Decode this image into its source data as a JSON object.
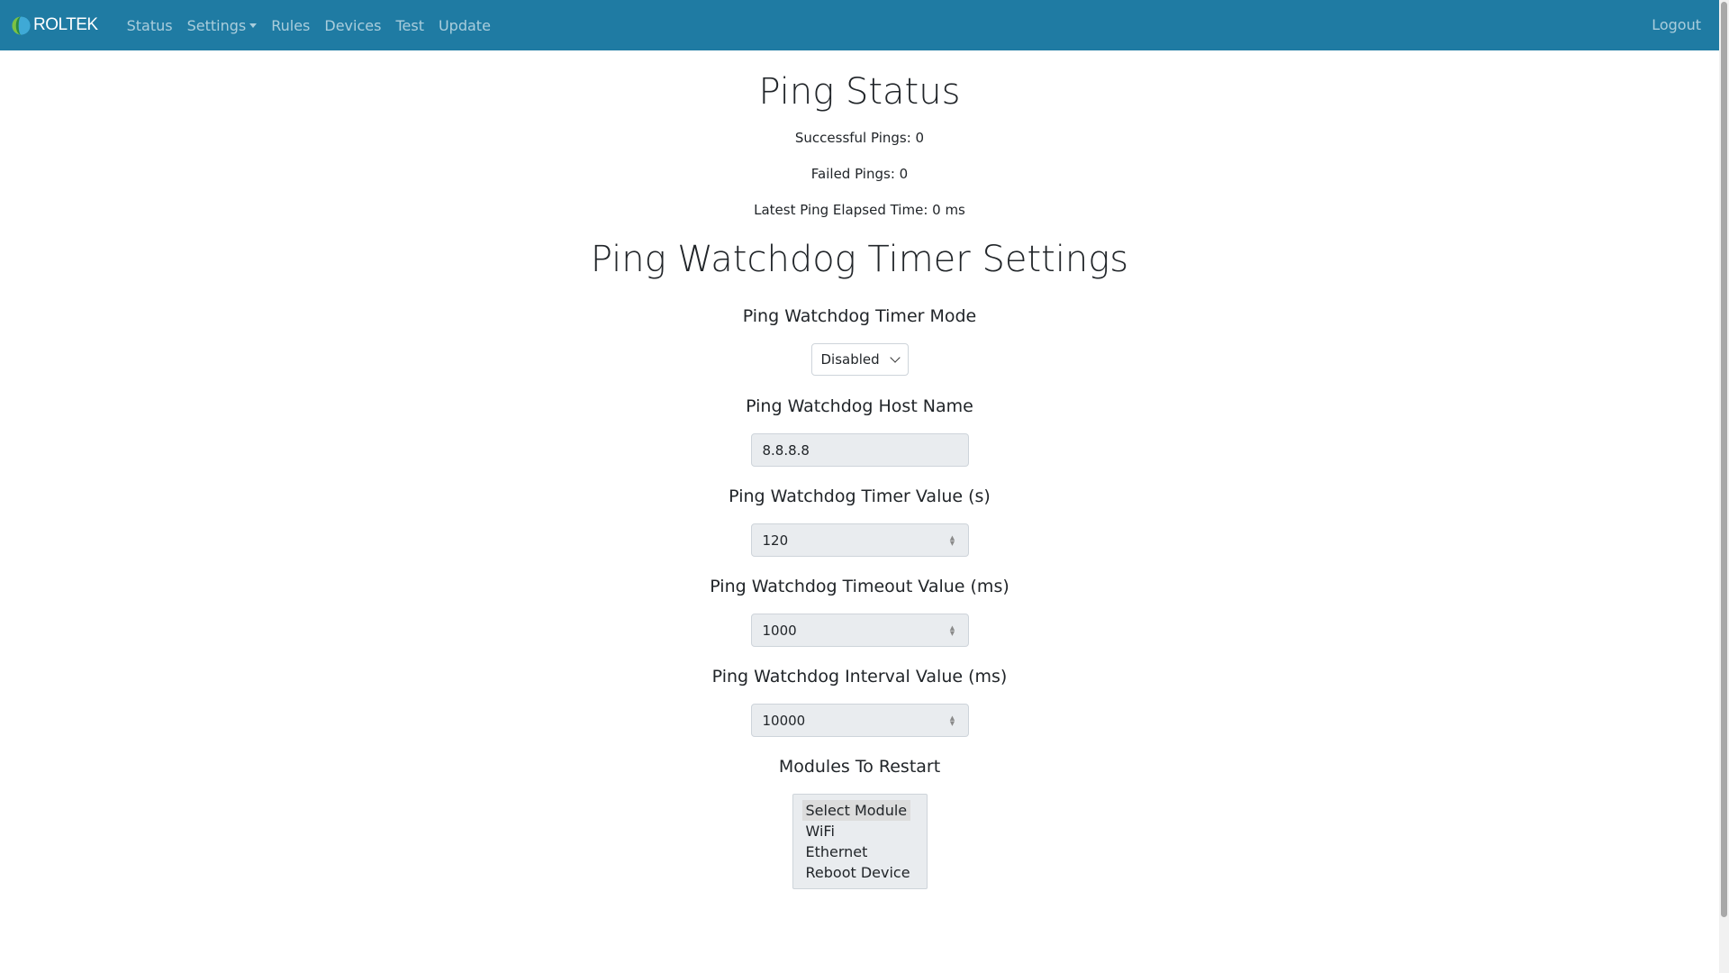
{
  "nav": {
    "brand": "ROLTEK",
    "items": [
      "Status",
      "Settings",
      "Rules",
      "Devices",
      "Test",
      "Update"
    ],
    "logout": "Logout"
  },
  "status": {
    "title": "Ping Status",
    "successful": "Successful Pings: 0",
    "failed": "Failed Pings: 0",
    "latest": "Latest Ping Elapsed Time: 0 ms"
  },
  "settings": {
    "title": "Ping Watchdog Timer Settings",
    "mode_label": "Ping Watchdog Timer Mode",
    "mode_value": "Disabled",
    "host_label": "Ping Watchdog Host Name",
    "host_value": "8.8.8.8",
    "timer_label": "Ping Watchdog Timer Value (s)",
    "timer_value": "120",
    "timeout_label": "Ping Watchdog Timeout Value (ms)",
    "timeout_value": "1000",
    "interval_label": "Ping Watchdog Interval Value (ms)",
    "interval_value": "10000",
    "modules_label": "Modules To Restart",
    "modules": [
      "Select Module",
      "WiFi",
      "Ethernet",
      "Reboot Device"
    ]
  },
  "colors": {
    "navbar": "#1f7ba3",
    "input_bg": "#e9ecef"
  }
}
